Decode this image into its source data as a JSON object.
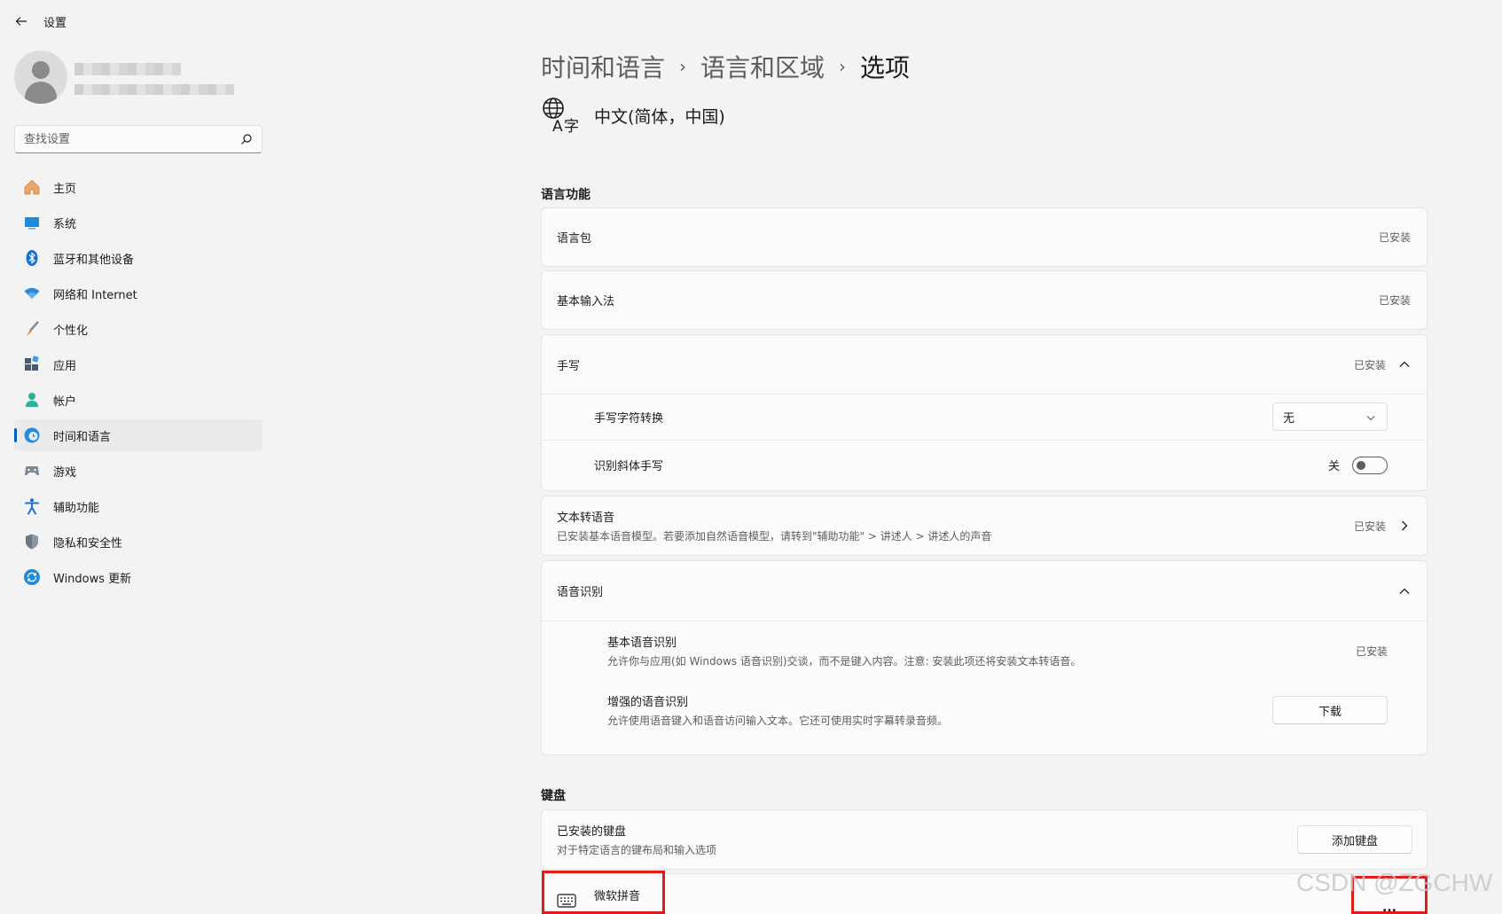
{
  "app": {
    "title": "设置"
  },
  "search": {
    "placeholder": "查找设置"
  },
  "nav": {
    "items": [
      {
        "label": "主页",
        "icon": "home-icon"
      },
      {
        "label": "系统",
        "icon": "system-icon"
      },
      {
        "label": "蓝牙和其他设备",
        "icon": "bluetooth-icon"
      },
      {
        "label": "网络和 Internet",
        "icon": "wifi-icon"
      },
      {
        "label": "个性化",
        "icon": "brush-icon"
      },
      {
        "label": "应用",
        "icon": "apps-icon"
      },
      {
        "label": "帐户",
        "icon": "account-icon"
      },
      {
        "label": "时间和语言",
        "icon": "time-language-icon",
        "active": true
      },
      {
        "label": "游戏",
        "icon": "gamepad-icon"
      },
      {
        "label": "辅助功能",
        "icon": "accessibility-icon"
      },
      {
        "label": "隐私和安全性",
        "icon": "shield-icon"
      },
      {
        "label": "Windows 更新",
        "icon": "windows-update-icon"
      }
    ]
  },
  "breadcrumb": {
    "items": [
      "时间和语言",
      "语言和区域",
      "选项"
    ],
    "separator": "›"
  },
  "language": {
    "name": "中文(简体，中国)",
    "icon": "language-icon"
  },
  "sections": {
    "language_features": {
      "label": "语言功能",
      "language_pack": {
        "label": "语言包",
        "status": "已安装"
      },
      "basic_typing": {
        "label": "基本输入法",
        "status": "已安装"
      },
      "handwriting": {
        "label": "手写",
        "status": "已安装",
        "char_conversion": {
          "label": "手写字符转换",
          "value": "无"
        },
        "cursive": {
          "label": "识别斜体手写",
          "state": "关"
        }
      },
      "tts": {
        "label": "文本转语音",
        "description": "已安装基本语音模型。若要添加自然语音模型，请转到\"辅助功能\" > 讲述人 > 讲述人的声音",
        "status": "已安装"
      },
      "speech": {
        "label": "语音识别",
        "basic": {
          "label": "基本语音识别",
          "description": "允许你与应用(如 Windows 语音识别)交谈，而不是键入内容。注意: 安装此项还将安装文本转语音。",
          "status": "已安装"
        },
        "enhanced": {
          "label": "增强的语音识别",
          "description": "允许使用语音键入和语音访问输入文本。它还可使用实时字幕转录音频。",
          "button": "下载"
        }
      }
    },
    "keyboard": {
      "label": "键盘",
      "installed": {
        "label": "已安装的键盘",
        "description": "对于特定语言的键布局和输入选项",
        "button": "添加键盘"
      },
      "ime": {
        "label": "微软拼音",
        "more": "..."
      }
    }
  },
  "watermark": "CSDN @ZGCHW",
  "colors": {
    "accent": "#005fb8",
    "highlight": "#e21b1b"
  }
}
